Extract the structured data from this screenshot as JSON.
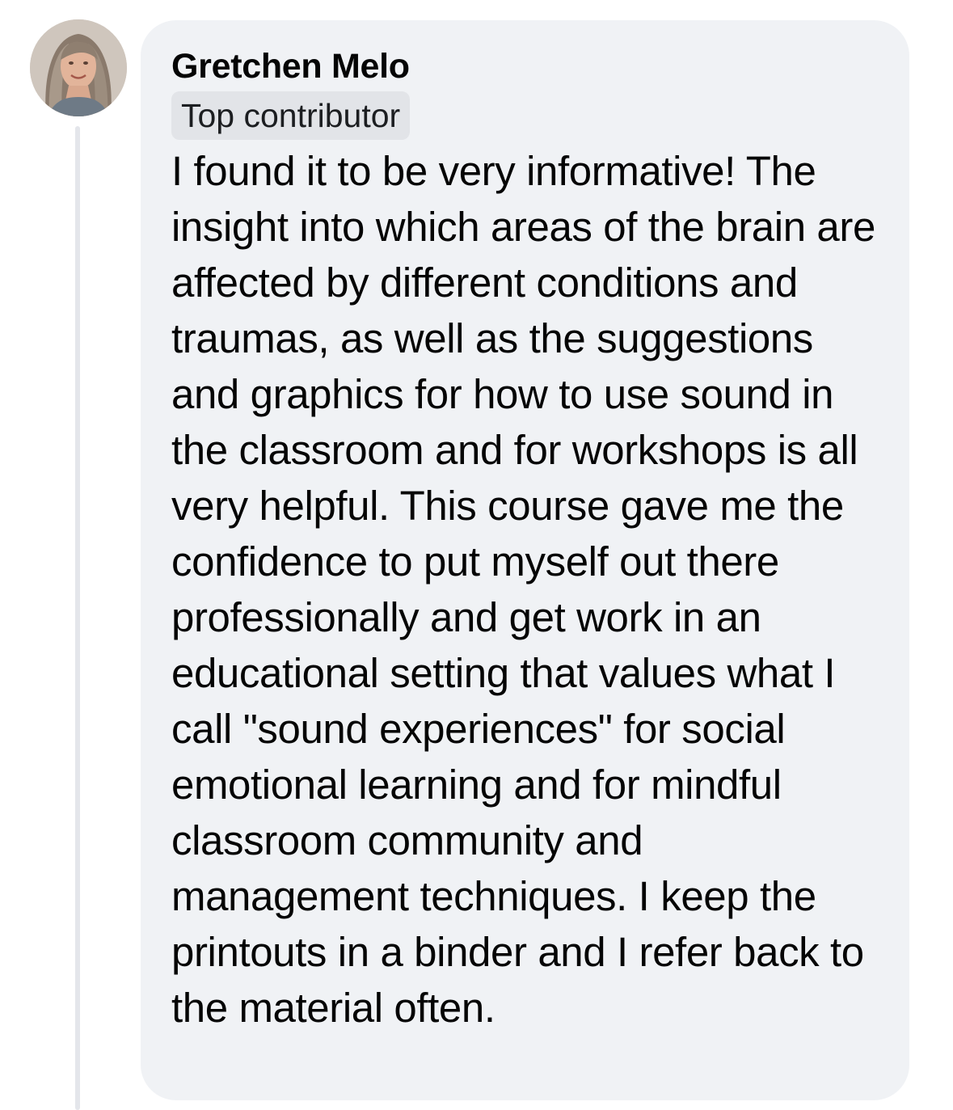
{
  "comment": {
    "author_name": "Gretchen Melo",
    "badge": "Top contributor",
    "body": "I found it to be very informative! The insight into which areas of the brain are affected by different conditions and traumas, as well as the suggestions and graphics for how to use sound in the classroom and for workshops is all very helpful. This course gave me the confidence to put myself out there professionally and get work in an educational setting that values what I call \"sound experiences\" for social emotional learning and for mindful classroom community and management techniques. I keep the printouts in a binder and I refer back to the material often."
  },
  "colors": {
    "bubble_background": "#f0f2f5",
    "badge_background": "#e2e4e8",
    "thread_line": "#e4e6eb",
    "text": "#050505"
  },
  "icons": {
    "avatar": "profile-photo"
  }
}
